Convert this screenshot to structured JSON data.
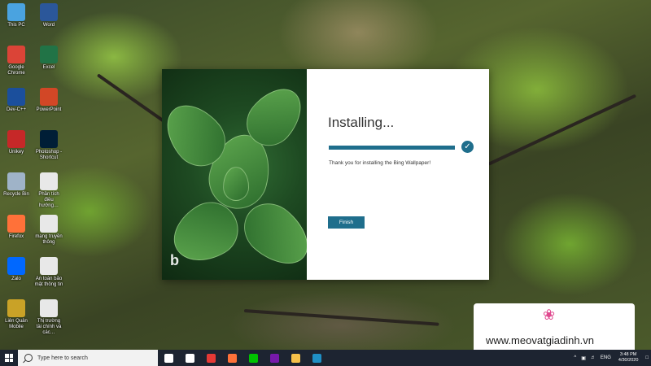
{
  "desktop": {
    "icons_col1": [
      {
        "label": "This PC",
        "icon": "this-pc-icon",
        "color": "#4aa3e0"
      },
      {
        "label": "Google Chrome",
        "icon": "chrome-icon",
        "color": "#db4437"
      },
      {
        "label": "Dev-C++",
        "icon": "devcpp-icon",
        "color": "#1b4f9c"
      },
      {
        "label": "Unikey",
        "icon": "unikey-icon",
        "color": "#c62828"
      },
      {
        "label": "Recycle Bin",
        "icon": "recycle-bin-icon",
        "color": "#9fb3c8"
      },
      {
        "label": "Firefox",
        "icon": "firefox-icon",
        "color": "#ff7139"
      },
      {
        "label": "Zalo",
        "icon": "zalo-icon",
        "color": "#0068ff"
      },
      {
        "label": "Liên Quân Mobile",
        "icon": "game-icon",
        "color": "#c9a227"
      }
    ],
    "icons_col2": [
      {
        "label": "Word",
        "icon": "word-icon",
        "color": "#2b579a"
      },
      {
        "label": "Excel",
        "icon": "excel-icon",
        "color": "#217346"
      },
      {
        "label": "PowerPoint",
        "icon": "powerpoint-icon",
        "color": "#d24726"
      },
      {
        "label": "Photoshop - Shortcut",
        "icon": "photoshop-icon",
        "color": "#001e36"
      },
      {
        "label": "Phần tích điều hướng…",
        "icon": "document-icon",
        "color": "#e8e8e8"
      },
      {
        "label": "mạng truyền thông",
        "icon": "document-icon",
        "color": "#e8e8e8"
      },
      {
        "label": "An toàn bảo mật thông tin",
        "icon": "document-icon",
        "color": "#e8e8e8"
      },
      {
        "label": "Thị trường tài chính và các…",
        "icon": "document-icon",
        "color": "#e8e8e8"
      }
    ]
  },
  "installer": {
    "title": "Installing...",
    "progress": 1.0,
    "message": "Thank you for installing the Bing Wallpaper!",
    "finish_label": "Finish",
    "accent": "#1f6e8c",
    "logo": "b"
  },
  "watermark": {
    "text": "www.meovatgiadinh.vn",
    "color": "#e0498f"
  },
  "taskbar": {
    "search_placeholder": "Type here to search",
    "apps": [
      {
        "icon": "cortana-icon",
        "color": "#ffffff"
      },
      {
        "icon": "task-view-icon",
        "color": "#ffffff"
      },
      {
        "icon": "game-app-icon",
        "color": "#e53935"
      },
      {
        "icon": "firefox-icon",
        "color": "#ff7139"
      },
      {
        "icon": "line-icon",
        "color": "#00c300"
      },
      {
        "icon": "onenote-icon",
        "color": "#7719aa"
      },
      {
        "icon": "file-explorer-icon",
        "color": "#f5c04a"
      },
      {
        "icon": "bing-icon",
        "color": "#1f8fc4"
      }
    ],
    "language": "ENG",
    "time": "3:48 PM",
    "date": "4/30/2020"
  }
}
